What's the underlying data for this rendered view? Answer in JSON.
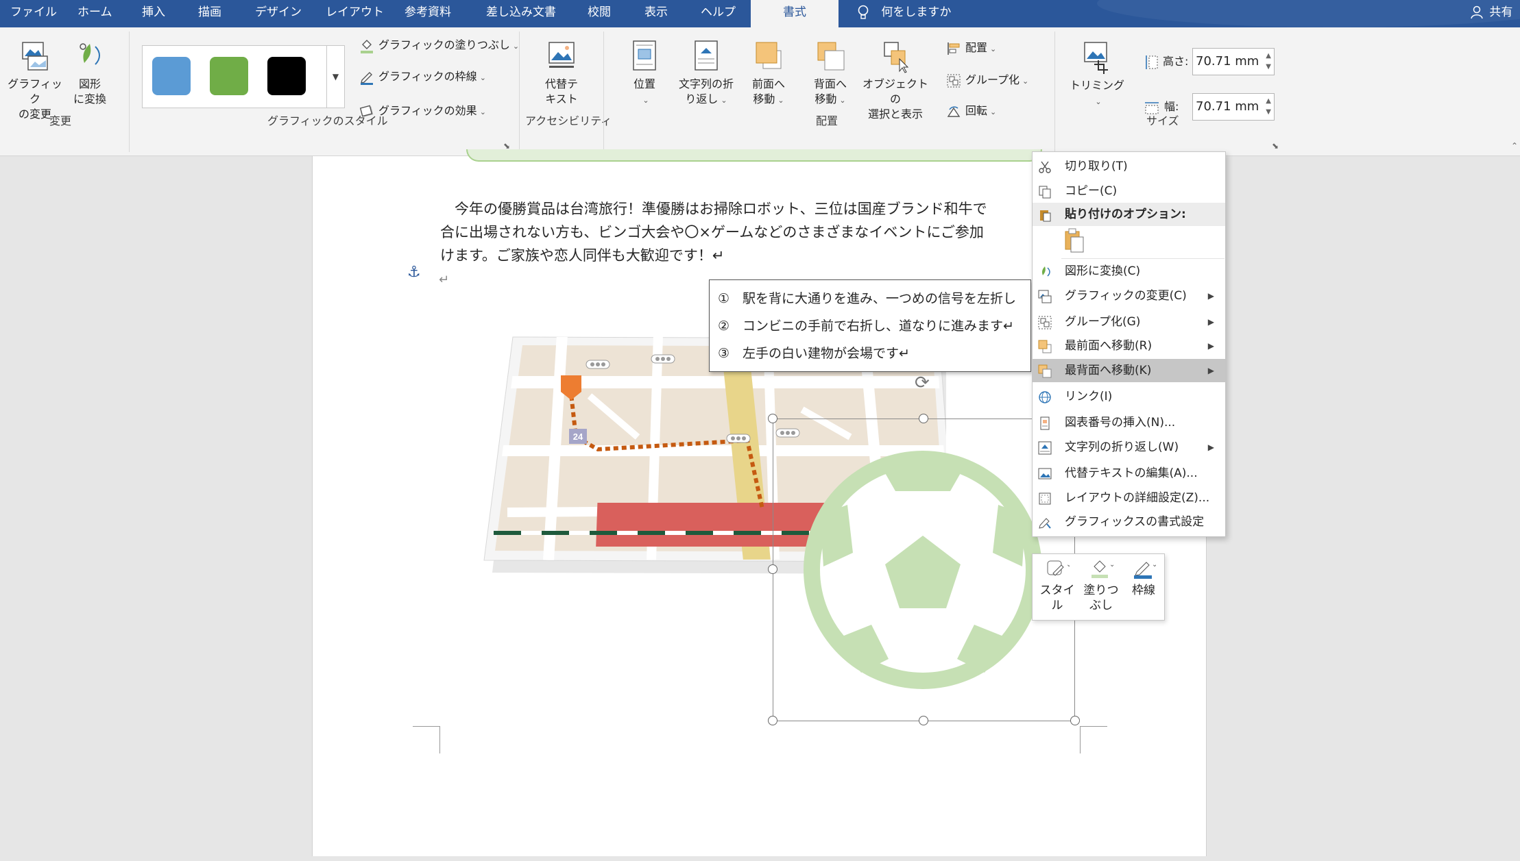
{
  "tabs": [
    {
      "label": "ファイル"
    },
    {
      "label": "ホーム"
    },
    {
      "label": "挿入"
    },
    {
      "label": "描画"
    },
    {
      "label": "デザイン"
    },
    {
      "label": "レイアウト"
    },
    {
      "label": "参考資料"
    },
    {
      "label": "差し込み文書"
    },
    {
      "label": "校閲"
    },
    {
      "label": "表示"
    },
    {
      "label": "ヘルプ"
    },
    {
      "label": "書式"
    }
  ],
  "tell_me": "何をしますか",
  "share": "共有",
  "ribbon": {
    "change_group": {
      "label": "変更",
      "change_graphic": "グラフィック\nの変更",
      "convert_shape": "図形\nに変換"
    },
    "style_group": {
      "label": "グラフィックのスタイル",
      "swatch_colors": [
        "#5b9bd5",
        "#70ad47",
        "#000000"
      ],
      "fill": "グラフィックの塗りつぶし",
      "outline": "グラフィックの枠線",
      "effects": "グラフィックの効果"
    },
    "access_group": {
      "label": "アクセシビリティ",
      "alt_text": "代替テ\nキスト"
    },
    "arrange_group": {
      "label": "配置",
      "position": "位置",
      "wrap_text": "文字列の折\nり返し",
      "bring_forward": "前面へ\n移動",
      "send_backward": "背面へ\n移動",
      "selection_pane": "オブジェクトの\n選択と表示",
      "align": "配置",
      "group": "グループ化",
      "rotate": "回転"
    },
    "size_group": {
      "label": "サイズ",
      "crop": "トリミング",
      "height_label": "高さ:",
      "height_value": "70.71 mm",
      "width_label": "幅:",
      "width_value": "70.71 mm"
    }
  },
  "document": {
    "para_lines": [
      "　今年の優勝賞品は台湾旅行！準優勝はお掃除ロボット、三位は国産ブランド和牛で",
      "合に出場されない方も、ビンゴ大会や〇×ゲームなどのさまざまなイベントにご参加",
      "けます。ご家族や恋人同伴も大歓迎です！↵"
    ],
    "empty_para": "↵",
    "anchor_icon": "anchor-icon",
    "directions": [
      "①　駅を背に大通りを進み、一つめの信号を左折し",
      "②　コンビニの手前で右折し、道なりに進みます↵",
      "③　左手の白い建物が会場です↵"
    ],
    "map_sign": "24"
  },
  "context_menu": {
    "items": [
      {
        "label": "切り取り(T)",
        "icon": "scissors-icon"
      },
      {
        "label": "コピー(C)",
        "icon": "copy-icon"
      },
      {
        "label": "貼り付けのオプション:",
        "icon": "paste-icon"
      },
      {
        "label": "図形に変換(C)",
        "icon": "convert-icon"
      },
      {
        "label": "グラフィックの変更(C)",
        "icon": "change-graphic-icon",
        "submenu": true
      },
      {
        "label": "グループ化(G)",
        "icon": "group-icon",
        "submenu": true
      },
      {
        "label": "最前面へ移動(R)",
        "icon": "bring-front-icon",
        "submenu": true
      },
      {
        "label": "最背面へ移動(K)",
        "icon": "send-back-icon",
        "submenu": true,
        "highlighted": true
      },
      {
        "label": "リンク(I)",
        "icon": "link-icon"
      },
      {
        "label": "図表番号の挿入(N)...",
        "icon": "caption-icon"
      },
      {
        "label": "文字列の折り返し(W)",
        "icon": "wrap-icon",
        "submenu": true
      },
      {
        "label": "代替テキストの編集(A)...",
        "icon": "alt-text-icon"
      },
      {
        "label": "レイアウトの詳細設定(Z)...",
        "icon": "layout-icon"
      },
      {
        "label": "グラフィックスの書式設定",
        "icon": "format-icon"
      }
    ]
  },
  "mini_toolbar": {
    "style": "スタイル",
    "fill": "塗りつ\nぶし",
    "outline": "枠線"
  }
}
